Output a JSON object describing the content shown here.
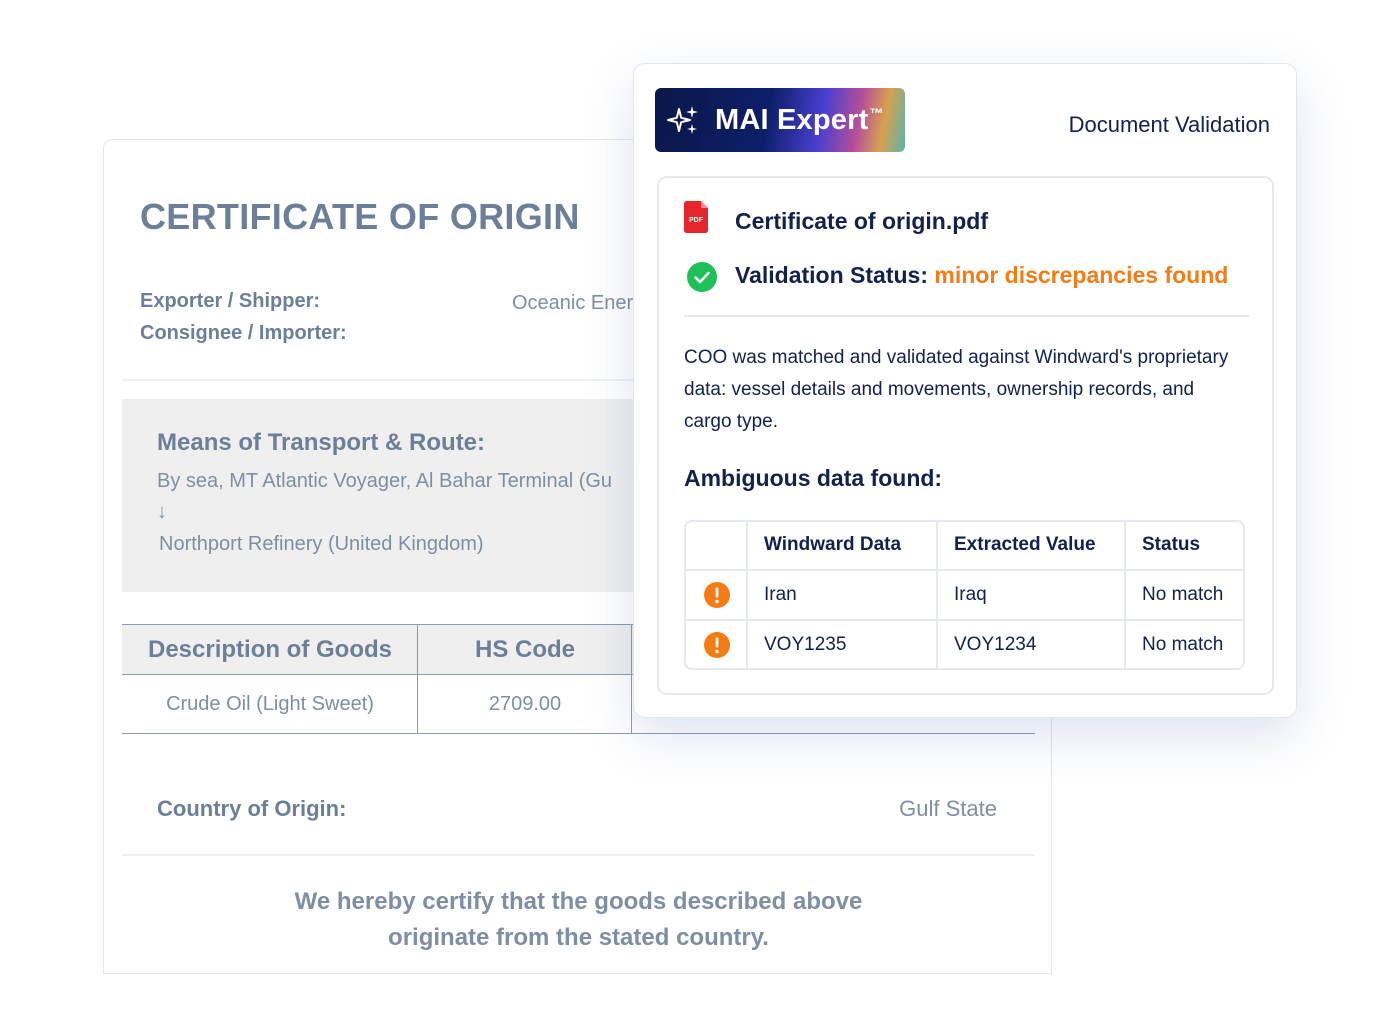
{
  "certificate": {
    "title": "CERTIFICATE OF ORIGIN",
    "exporter_label": "Exporter / Shipper:",
    "exporter_value": "Oceanic Ener",
    "consignee_label": "Consignee / Importer:",
    "route_title": "Means of Transport & Route:",
    "route_from": "By sea, MT Atlantic Voyager, Al Bahar Terminal (Gu",
    "route_arrow": "↓",
    "route_to": "Northport Refinery (United Kingdom)",
    "goods_headers": [
      "Description of Goods",
      "HS Code"
    ],
    "goods_row": [
      "Crude Oil (Light Sweet)",
      "2709.00"
    ],
    "country_label": "Country of Origin:",
    "country_value": "Gulf State",
    "certify_line1": "We hereby certify that the goods described above",
    "certify_line2": "originate from the stated country."
  },
  "panel": {
    "badge_text": "MAI Expert",
    "badge_tm": "™",
    "badge_icon": "sparkles-icon",
    "header_title": "Document Validation",
    "file_name": "Certificate of origin.pdf",
    "pdf_icon_label": "PDF",
    "status_label": "Validation Status:",
    "status_value": "minor discrepancies found",
    "description": "COO was matched and validated against Windward's proprietary data: vessel details and movements, ownership records, and cargo type.",
    "ambiguous_title": "Ambiguous data found:",
    "table": {
      "headers": [
        "Windward Data",
        "Extracted Value",
        "Status"
      ],
      "rows": [
        {
          "windward": "Iran",
          "extracted": "Iraq",
          "status": "No match"
        },
        {
          "windward": "VOY1235",
          "extracted": "VOY1234",
          "status": "No match"
        }
      ]
    }
  },
  "colors": {
    "status_warning": "#f57c14",
    "status_ok": "#1fc05a",
    "navy": "#12214d",
    "doc_text": "#6b7f99"
  }
}
